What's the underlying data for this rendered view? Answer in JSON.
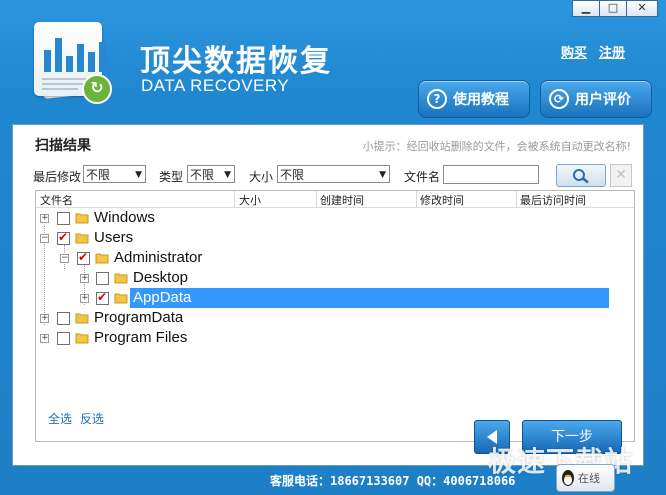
{
  "window": {
    "minimize": "▁",
    "maximize": "□",
    "close": "✕"
  },
  "brand": {
    "title_cn": "顶尖数据恢复",
    "title_en": "DATA RECOVERY"
  },
  "header_links": {
    "buy": "购买",
    "register": "注册"
  },
  "header_buttons": {
    "tutorial": "使用教程",
    "review": "用户评价"
  },
  "scan": {
    "title": "扫描结果",
    "tip": "小提示：经回收站删除的文件，会被系统自动更改名称!"
  },
  "filters": {
    "last_modified_label": "最后修改",
    "last_modified_value": "不限",
    "type_label": "类型",
    "type_value": "不限",
    "size_label": "大小",
    "size_value": "不限",
    "filename_label": "文件名",
    "filename_value": ""
  },
  "columns": {
    "name": "文件名",
    "size": "大小",
    "created": "创建时间",
    "modified": "修改时间",
    "accessed": "最后访问时间"
  },
  "tree": {
    "windows": "Windows",
    "users": "Users",
    "administrator": "Administrator",
    "desktop": "Desktop",
    "appdata": "AppData",
    "programdata": "ProgramData",
    "programfiles": "Program Files"
  },
  "select": {
    "all": "全选",
    "invert": "反选"
  },
  "nav": {
    "next": "下一步"
  },
  "footer": {
    "support": "客服电话：18667133607  QQ：4006718066"
  },
  "qq_button": {
    "label": "在线"
  },
  "watermark": {
    "text": "极速下载站"
  },
  "colors": {
    "accent": "#1f86d0",
    "selection": "#3399ff",
    "check": "#d60000"
  }
}
